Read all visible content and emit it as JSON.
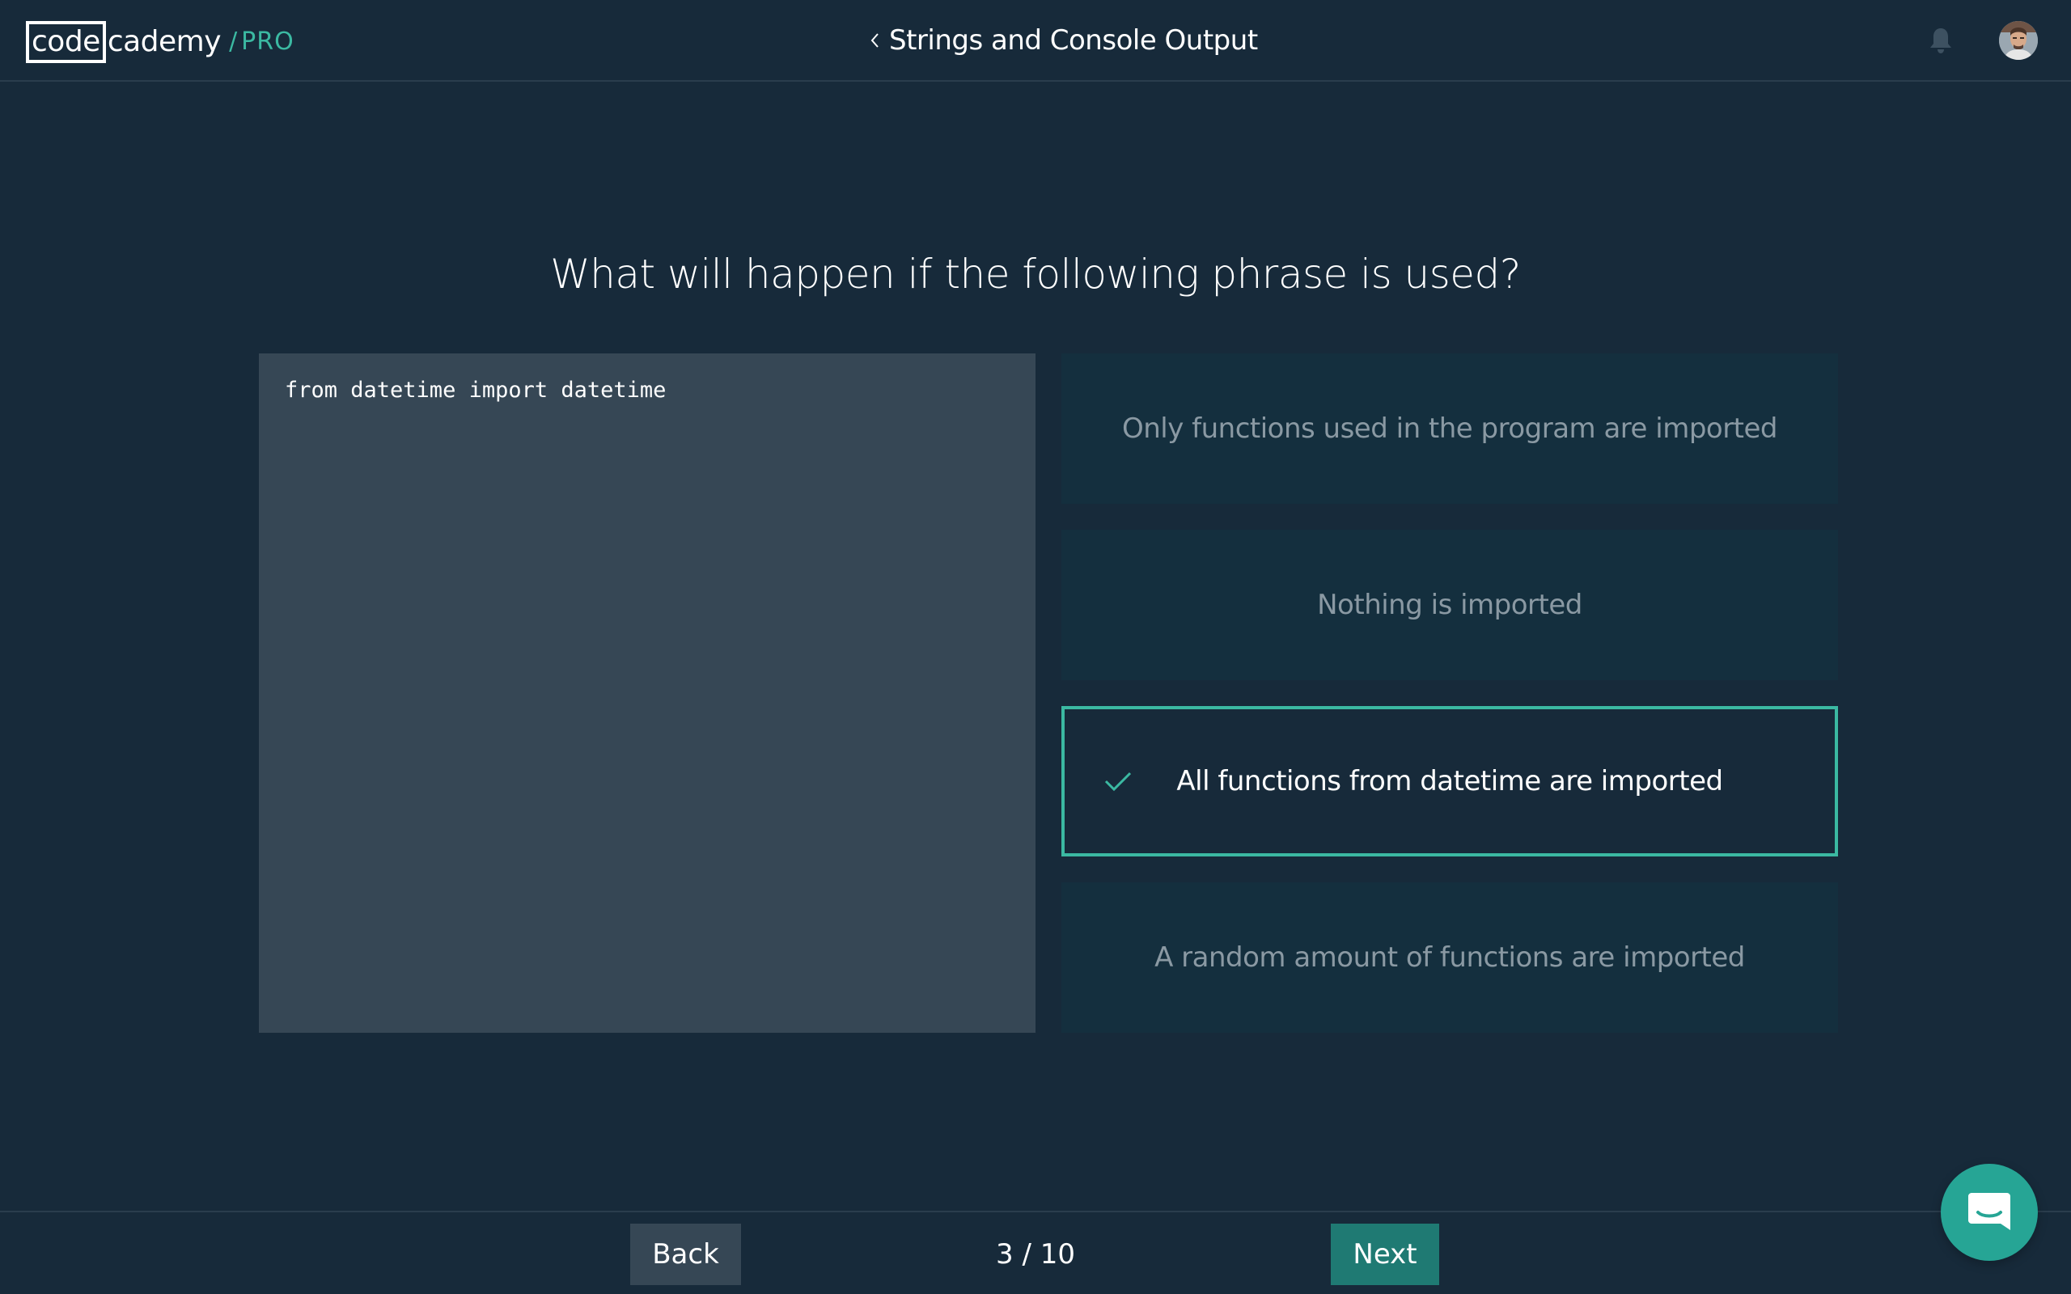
{
  "header": {
    "logo": {
      "boxed_part": "code",
      "rest": "cademy",
      "slash": "/",
      "pro": "PRO"
    },
    "breadcrumb": {
      "chevron_icon": "chevron-left-icon",
      "title": "Strings and Console Output"
    },
    "notification_icon": "bell-icon",
    "avatar_icon": "user-avatar"
  },
  "quiz": {
    "question": "What will happen if the following phrase is used?",
    "code": "from datetime import datetime",
    "options": [
      {
        "label": "Only functions used in the program are imported",
        "selected": false
      },
      {
        "label": "Nothing is imported",
        "selected": false
      },
      {
        "label": "All functions from datetime are imported",
        "selected": true
      },
      {
        "label": "A random amount of functions are imported",
        "selected": false
      }
    ],
    "selected_icon": "check-icon"
  },
  "footer": {
    "back_label": "Back",
    "progress": "3 / 10",
    "next_label": "Next"
  },
  "chat": {
    "icon": "chat-bubble-icon"
  },
  "colors": {
    "background": "#172a3a",
    "accent": "#3bb9a2",
    "next_button": "#1f7a73",
    "code_panel": "#364755",
    "option_bg": "#142f3e",
    "chat_button": "#26a595"
  }
}
